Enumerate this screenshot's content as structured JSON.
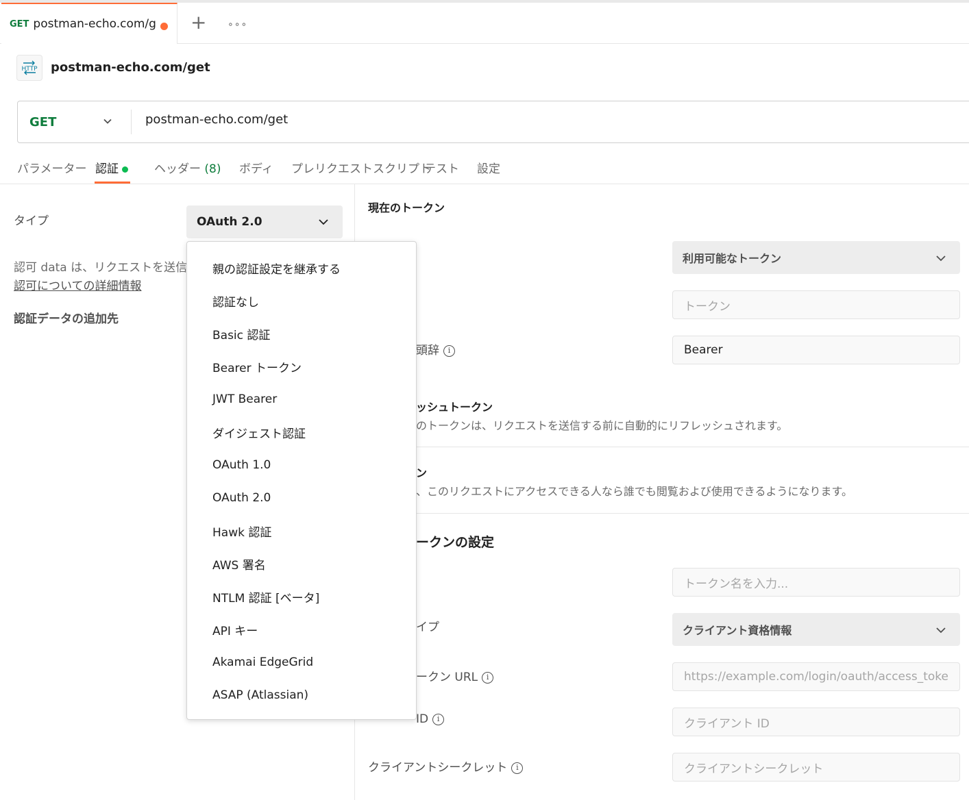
{
  "tab": {
    "method": "GET",
    "title": "postman-echo.com/ge"
  },
  "header": {
    "icon_text": "HTTP",
    "request_name": "postman-echo.com/get"
  },
  "urlbar": {
    "method": "GET",
    "url": "postman-echo.com/get"
  },
  "subtabs": {
    "params": "パラメーター",
    "auth": "認証",
    "headers": "ヘッダー",
    "headers_count": "(8)",
    "body": "ボディ",
    "prerequest": "プレリクエストスクリプト",
    "tests": "テスト",
    "settings": "設定"
  },
  "left": {
    "type_label": "タイプ",
    "type_value": "OAuth 2.0",
    "desc": "認可 data は、リクエストを送信する",
    "more_link": "認可についての詳細情報",
    "add_to_label": "認証データの追加先"
  },
  "menu": {
    "items": [
      "親の認証設定を継承する",
      "認証なし",
      "Basic 認証",
      "Bearer トークン",
      "JWT Bearer",
      "ダイジェスト認証",
      "OAuth 1.0",
      "OAuth 2.0",
      "Hawk 認証",
      "AWS 署名",
      "NTLM 認証 [ベータ]",
      "API キー",
      "Akamai EdgeGrid",
      "ASAP (Atlassian)"
    ]
  },
  "right": {
    "current_token_heading": "現在のトークン",
    "available_tokens": "利用可能なトークン",
    "token_placeholder": "トークン",
    "prefix_label": "頭辞",
    "prefix_value": "Bearer",
    "refresh_label": "ッシュトークン",
    "refresh_desc": "のトークンは、リクエストを送信する前に自動的にリフレッシュされます。",
    "share_label": "ン",
    "share_desc": "、このリクエストにアクセスできる人なら誰でも閲覧および使用できるようになります。",
    "new_token_title": "ークンの設定",
    "token_name_placeholder": "トークン名を入力...",
    "grant_type_label": "イプ",
    "grant_type_value": "クライアント資格情報",
    "access_token_url_label": "ークン URL",
    "access_token_url_placeholder": "https://example.com/login/oauth/access_toke",
    "client_id_label": "ID",
    "client_id_placeholder": "クライアント ID",
    "client_secret_label": "クライアントシークレット",
    "client_secret_placeholder": "クライアントシークレット"
  },
  "colors": {
    "accent": "#ff6c37",
    "get_method": "#0f7d3d",
    "status_dot": "#0cbb52"
  }
}
